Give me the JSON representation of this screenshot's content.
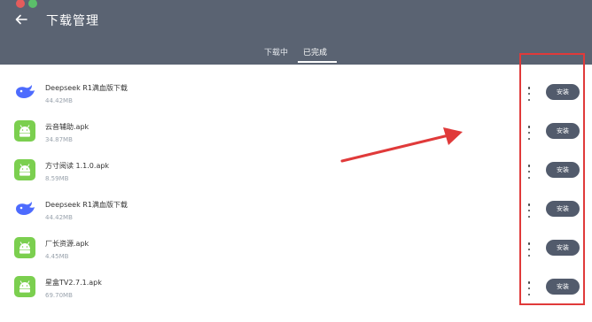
{
  "colors": {
    "header_bg": "#5a6372",
    "accent_button": "#525b6c",
    "annotation_red": "#e03a3a",
    "android_green": "#7bcf4f",
    "deepseek_blue": "#4d6bfe"
  },
  "header": {
    "back_icon": "arrow-left-icon",
    "title": "下载管理",
    "tabs": [
      {
        "label": "下载中",
        "selected": false
      },
      {
        "label": "已完成",
        "selected": true
      }
    ]
  },
  "downloads": [
    {
      "icon": "deepseek-whale-icon",
      "name": "Deepseek R1满血版下载",
      "size": "44.42MB",
      "action": "安装"
    },
    {
      "icon": "android-icon",
      "name": "云音辅助.apk",
      "size": "34.87MB",
      "action": "安装"
    },
    {
      "icon": "android-icon",
      "name": "方寸阅读 1.1.0.apk",
      "size": "8.59MB",
      "action": "安装"
    },
    {
      "icon": "deepseek-whale-icon",
      "name": "Deepseek R1满血版下载",
      "size": "44.42MB",
      "action": "安装"
    },
    {
      "icon": "android-icon",
      "name": "厂长资源.apk",
      "size": "4.45MB",
      "action": "安装"
    },
    {
      "icon": "android-icon",
      "name": "星盒TV2.7.1.apk",
      "size": "69.70MB",
      "action": "安装"
    }
  ]
}
